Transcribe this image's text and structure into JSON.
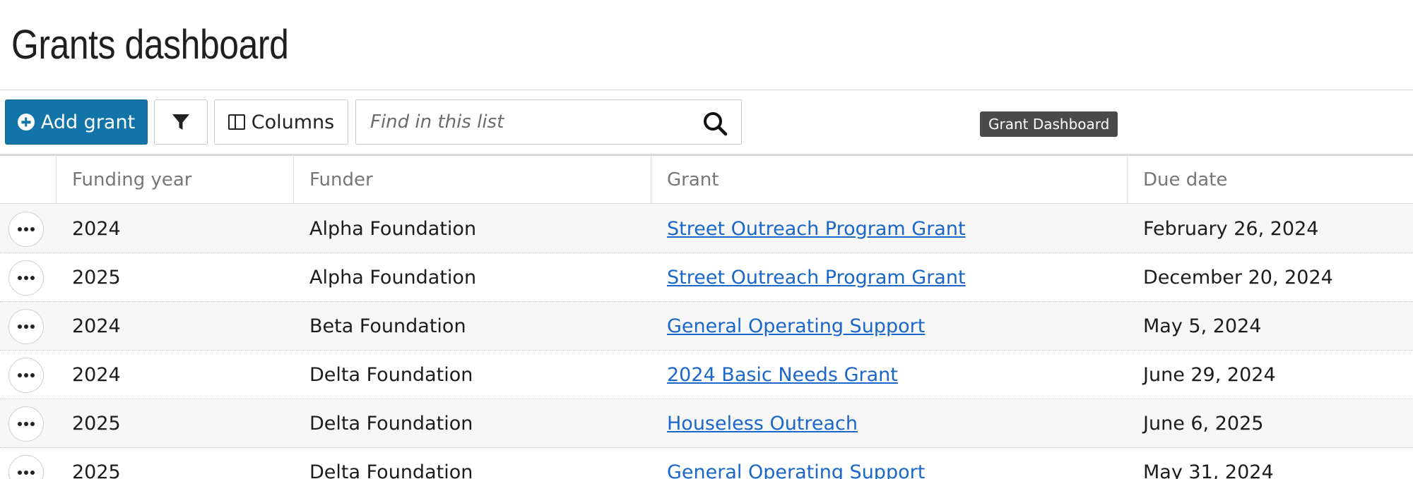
{
  "page": {
    "title": "Grants dashboard"
  },
  "toolbar": {
    "add_label": "Add grant",
    "columns_label": "Columns",
    "search_placeholder": "Find in this list"
  },
  "tooltip": "Grant Dashboard",
  "table": {
    "columns": [
      "Funding year",
      "Funder",
      "Grant",
      "Due date"
    ],
    "rows": [
      {
        "year": "2024",
        "funder": "Alpha Foundation",
        "grant": "Street Outreach Program Grant",
        "due": "February 26, 2024"
      },
      {
        "year": "2025",
        "funder": "Alpha Foundation",
        "grant": "Street Outreach Program Grant",
        "due": "December 20, 2024"
      },
      {
        "year": "2024",
        "funder": "Beta Foundation",
        "grant": "General Operating Support",
        "due": "May 5, 2024"
      },
      {
        "year": "2024",
        "funder": "Delta Foundation",
        "grant": "2024 Basic Needs Grant",
        "due": "June 29, 2024"
      },
      {
        "year": "2025",
        "funder": "Delta Foundation",
        "grant": "Houseless Outreach",
        "due": "June 6, 2025"
      },
      {
        "year": "2025",
        "funder": "Delta Foundation",
        "grant": "General Operating Support",
        "due": "May 31, 2024"
      }
    ]
  },
  "colors": {
    "accent": "#1274a8",
    "link": "#1a66c9",
    "tooltip_bg": "#4a4a4a"
  }
}
